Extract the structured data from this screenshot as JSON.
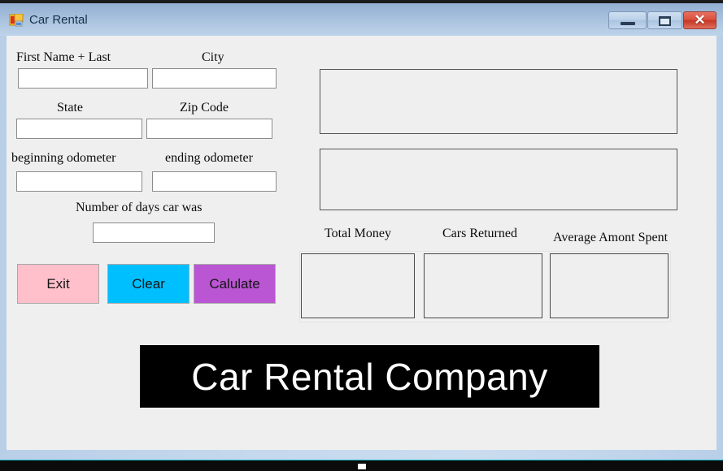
{
  "window": {
    "title": "Car Rental",
    "icon": "winforms-icon",
    "controls": {
      "minimize_label": "–",
      "maximize_label": "□",
      "close_label": "✕"
    }
  },
  "form": {
    "fields": [
      {
        "label": "First Name + Last",
        "value": "",
        "placeholder": ""
      },
      {
        "label": "City",
        "value": "",
        "placeholder": ""
      },
      {
        "label": "State",
        "value": "",
        "placeholder": ""
      },
      {
        "label": "Zip Code",
        "value": "",
        "placeholder": ""
      },
      {
        "label": "beginning odometer",
        "value": "",
        "placeholder": ""
      },
      {
        "label": "ending odometer",
        "value": "",
        "placeholder": ""
      },
      {
        "label": "Number of days car was",
        "value": "",
        "placeholder": ""
      }
    ],
    "buttons": [
      {
        "label": "Exit",
        "color": "#ffc0cb"
      },
      {
        "label": "Clear",
        "color": "#00bfff"
      },
      {
        "label": "Calulate",
        "color": "#ba55d3"
      }
    ],
    "output_panels": [
      {
        "value": ""
      },
      {
        "value": ""
      }
    ],
    "results": [
      {
        "label": "Total Money",
        "value": ""
      },
      {
        "label": "Cars Returned",
        "value": ""
      },
      {
        "label": "Average Amont Spent",
        "value": ""
      }
    ],
    "banner": {
      "text": "Car Rental Company",
      "background": "#000000",
      "text_color": "#ffffff"
    }
  }
}
